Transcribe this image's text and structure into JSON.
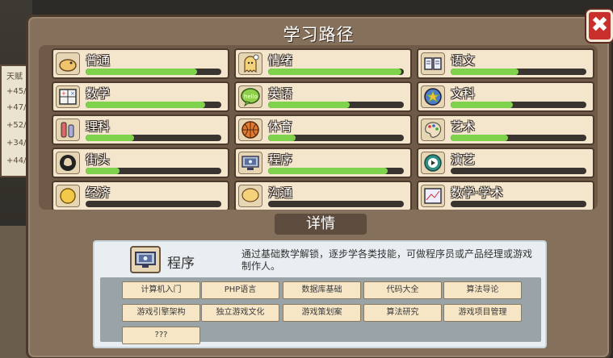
{
  "background": {
    "side_texts": [
      "天赋",
      "+45/",
      "+47/",
      "+52/",
      "+34/",
      "+44/"
    ]
  },
  "window": {
    "title": "学习路径",
    "close_label": "✖"
  },
  "paths": [
    {
      "label": "普通",
      "progress": 0.82,
      "icon": "egg-creature-icon"
    },
    {
      "label": "情绪",
      "progress": 0.98,
      "icon": "thinking-ghost-icon"
    },
    {
      "label": "语文",
      "progress": 0.5,
      "icon": "open-book-icon"
    },
    {
      "label": "数学",
      "progress": 0.88,
      "icon": "calculator-icon"
    },
    {
      "label": "英语",
      "progress": 0.6,
      "icon": "hello-speech-bubble-icon"
    },
    {
      "label": "文科",
      "progress": 0.46,
      "icon": "globe-star-icon"
    },
    {
      "label": "理科",
      "progress": 0.36,
      "icon": "flask-icon"
    },
    {
      "label": "体育",
      "progress": 0.2,
      "icon": "basketball-icon"
    },
    {
      "label": "艺术",
      "progress": 0.42,
      "icon": "palette-icon"
    },
    {
      "label": "街头",
      "progress": 0.25,
      "icon": "street-fist-icon"
    },
    {
      "label": "程序",
      "progress": 0.88,
      "icon": "computer-monitor-icon"
    },
    {
      "label": "演艺",
      "progress": 0.0,
      "icon": "play-button-icon"
    },
    {
      "label": "经济",
      "progress": 0.0,
      "icon": "coin-icon"
    },
    {
      "label": "沟通",
      "progress": 0.0,
      "icon": "chat-bubble-icon"
    },
    {
      "label": "数学·学术",
      "progress": 0.0,
      "icon": "chart-board-icon"
    }
  ],
  "details": {
    "tab_label": "详情",
    "name": "程序",
    "description": "通过基础数学解锁，逐步学各类技能，可做程序员或产品经理或游戏制作人。",
    "courses": [
      "计算机入门",
      "PHP语言",
      "数据库基础",
      "代码大全",
      "算法导论",
      "游戏引擎架构",
      "独立游戏文化",
      "游戏策划案",
      "算法研究",
      "游戏项目管理",
      "???"
    ]
  },
  "colors": {
    "progress_fill": "#7fd24b",
    "close_button": "#c9302c"
  }
}
